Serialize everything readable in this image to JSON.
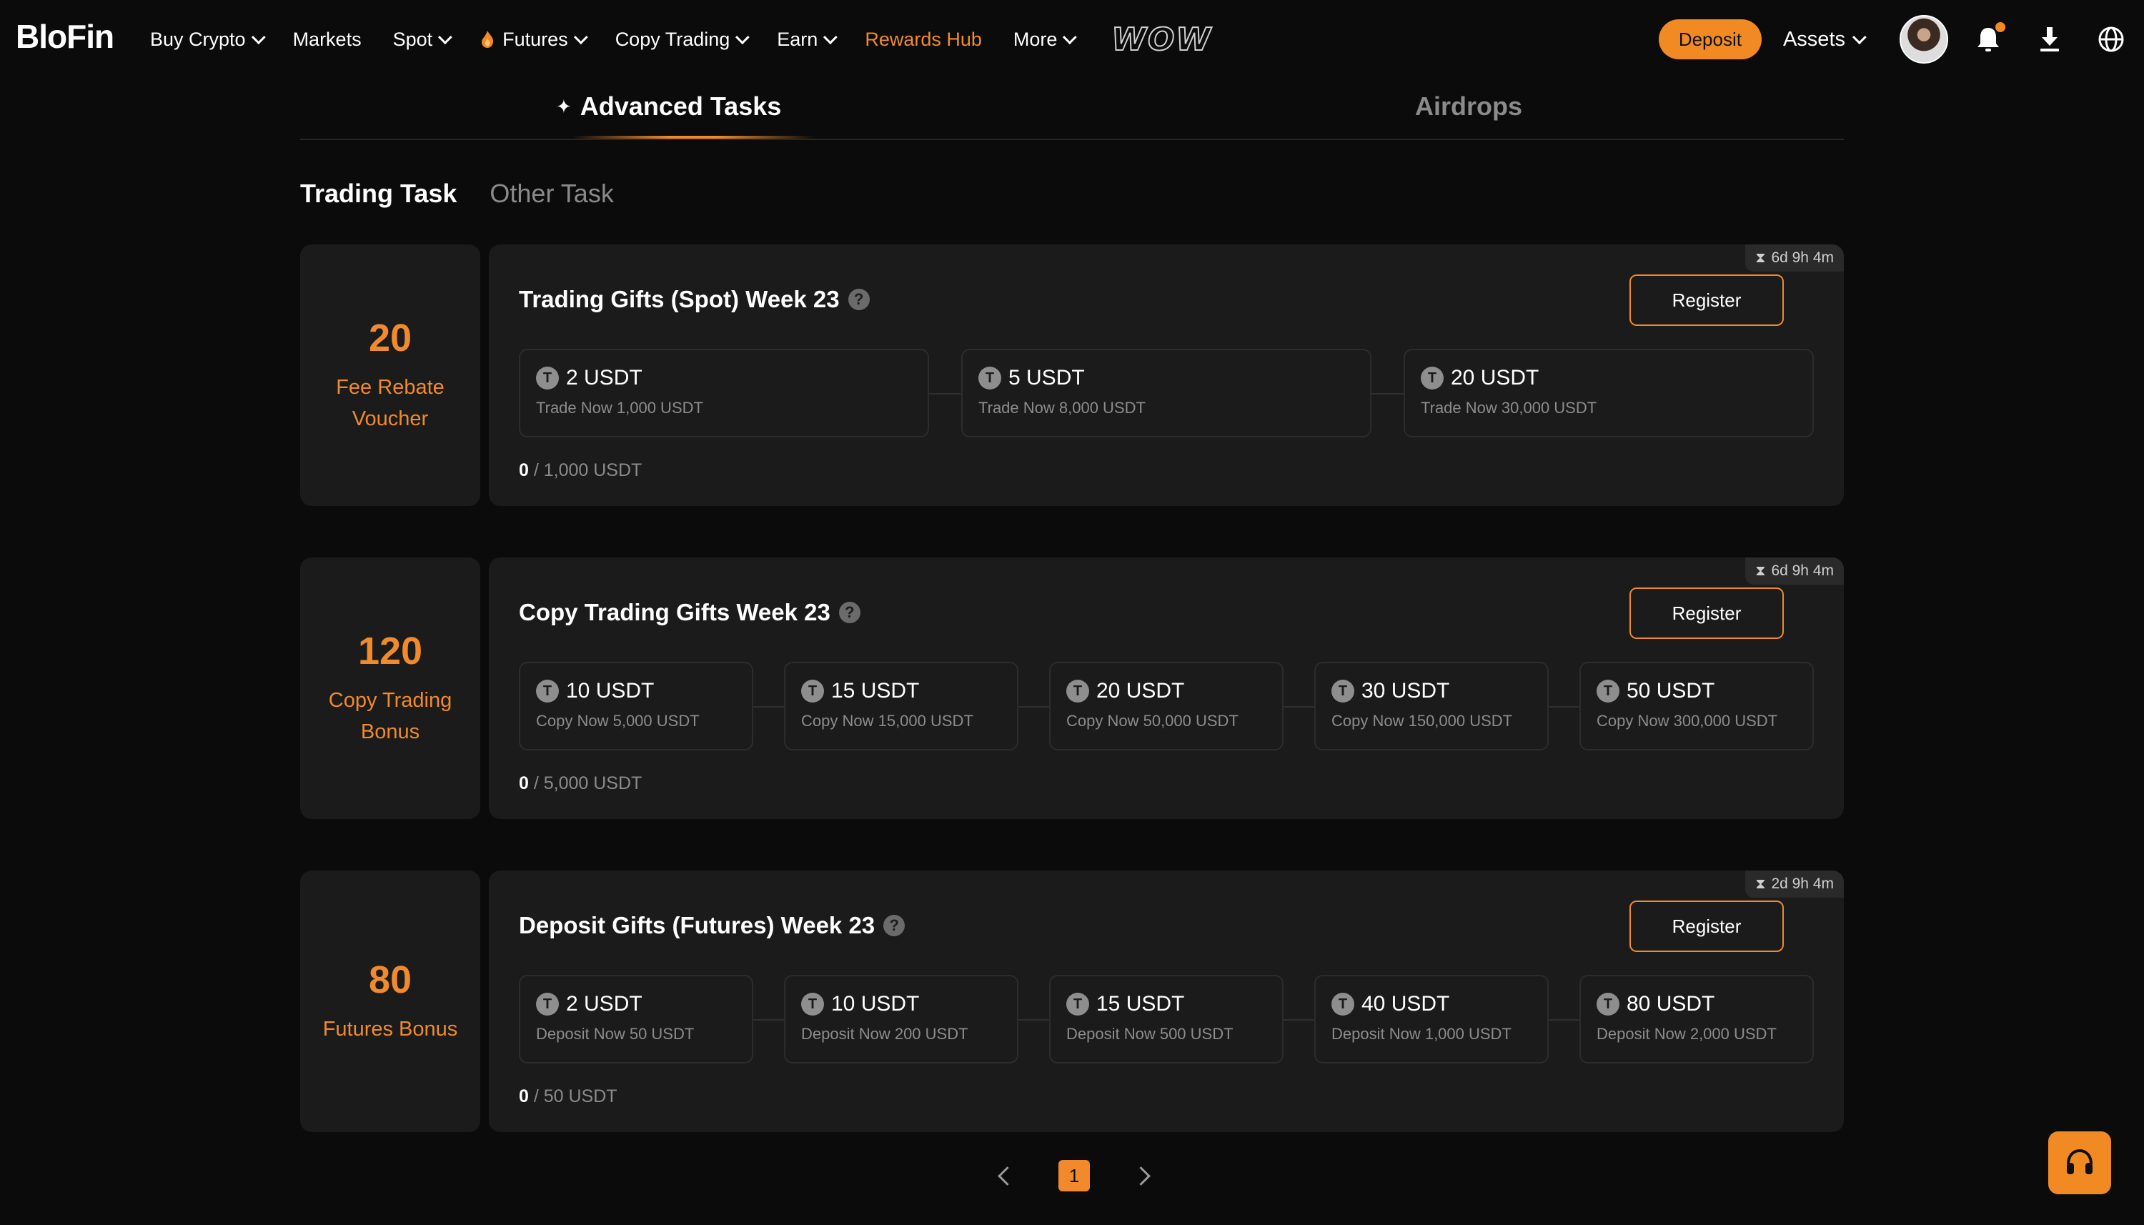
{
  "nav": {
    "logo": "BloFin",
    "items": [
      {
        "label": "Buy Crypto",
        "chevron": true
      },
      {
        "label": "Markets",
        "chevron": false
      },
      {
        "label": "Spot",
        "chevron": true
      },
      {
        "label": "Futures",
        "chevron": true,
        "icon": "flame-icon"
      },
      {
        "label": "Copy Trading",
        "chevron": true
      },
      {
        "label": "Earn",
        "chevron": true
      },
      {
        "label": "Rewards Hub",
        "chevron": false,
        "accent": true
      },
      {
        "label": "More",
        "chevron": true
      }
    ],
    "promo_logo": "WOW",
    "deposit_label": "Deposit",
    "assets_label": "Assets"
  },
  "main_tabs": {
    "active": "Advanced Tasks",
    "inactive": "Airdrops"
  },
  "sub_tabs": {
    "active": "Trading Task",
    "inactive": "Other Task"
  },
  "tasks": [
    {
      "reward_value": "20",
      "reward_label": "Fee Rebate Voucher",
      "timer": "6d 9h 4m",
      "title": "Trading Gifts (Spot) Week 23",
      "register_label": "Register",
      "progress_current": "0",
      "progress_target": "/ 1,000 USDT",
      "tiers": [
        {
          "amount": "2 USDT",
          "requirement": "Trade Now 1,000 USDT"
        },
        {
          "amount": "5 USDT",
          "requirement": "Trade Now 8,000 USDT"
        },
        {
          "amount": "20 USDT",
          "requirement": "Trade Now 30,000 USDT"
        }
      ]
    },
    {
      "reward_value": "120",
      "reward_label": "Copy Trading Bonus",
      "timer": "6d 9h 4m",
      "title": "Copy Trading Gifts Week 23",
      "register_label": "Register",
      "progress_current": "0",
      "progress_target": "/ 5,000 USDT",
      "tiers": [
        {
          "amount": "10 USDT",
          "requirement": "Copy Now 5,000 USDT"
        },
        {
          "amount": "15 USDT",
          "requirement": "Copy Now 15,000 USDT"
        },
        {
          "amount": "20 USDT",
          "requirement": "Copy Now 50,000 USDT"
        },
        {
          "amount": "30 USDT",
          "requirement": "Copy Now 150,000 USDT"
        },
        {
          "amount": "50 USDT",
          "requirement": "Copy Now 300,000 USDT"
        }
      ]
    },
    {
      "reward_value": "80",
      "reward_label": "Futures Bonus",
      "timer": "2d 9h 4m",
      "title": "Deposit Gifts (Futures) Week 23",
      "register_label": "Register",
      "progress_current": "0",
      "progress_target": "/ 50 USDT",
      "tiers": [
        {
          "amount": "2 USDT",
          "requirement": "Deposit Now 50 USDT"
        },
        {
          "amount": "10 USDT",
          "requirement": "Deposit Now 200 USDT"
        },
        {
          "amount": "15 USDT",
          "requirement": "Deposit Now 500 USDT"
        },
        {
          "amount": "40 USDT",
          "requirement": "Deposit Now 1,000 USDT"
        },
        {
          "amount": "80 USDT",
          "requirement": "Deposit Now 2,000 USDT"
        }
      ]
    }
  ],
  "pagination": {
    "current_page": "1"
  },
  "colors": {
    "accent": "#f08a2c",
    "background": "#0b0b0b",
    "card": "#1b1b1b"
  },
  "icons": [
    "flame-icon",
    "bell-icon",
    "download-icon",
    "globe-icon",
    "help-icon",
    "usdt-coin-icon",
    "hourglass-icon",
    "headset-icon",
    "chevron-left-icon",
    "chevron-right-icon"
  ]
}
